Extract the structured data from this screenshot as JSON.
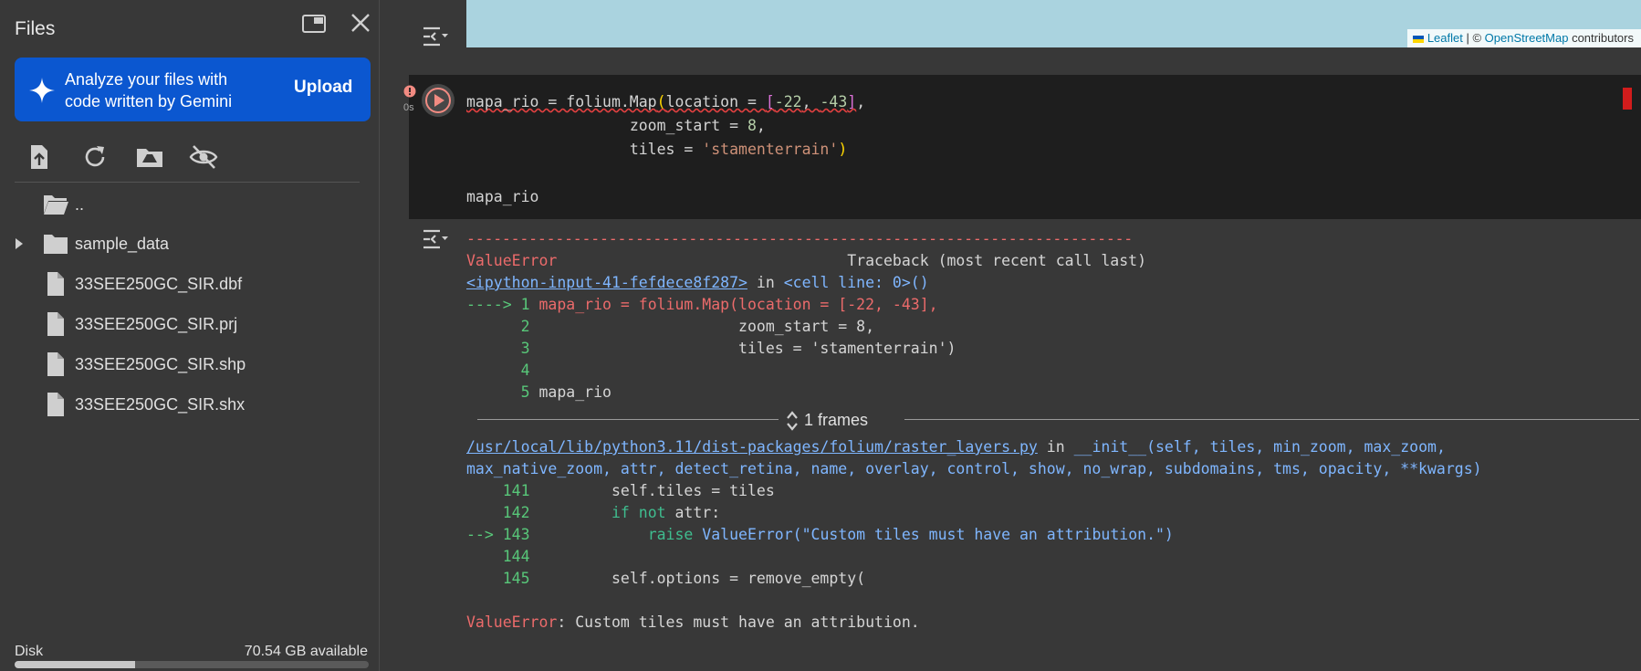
{
  "sidebar": {
    "title": "Files",
    "gemini": {
      "text": "Analyze your files with code written by Gemini",
      "upload_label": "Upload"
    },
    "tree": [
      {
        "label": "..",
        "kind": "parent-folder"
      },
      {
        "label": "sample_data",
        "kind": "folder"
      },
      {
        "label": "33SEE250GC_SIR.dbf",
        "kind": "file"
      },
      {
        "label": "33SEE250GC_SIR.prj",
        "kind": "file"
      },
      {
        "label": "33SEE250GC_SIR.shp",
        "kind": "file"
      },
      {
        "label": "33SEE250GC_SIR.shx",
        "kind": "file"
      }
    ],
    "disk": {
      "label": "Disk",
      "available": "70.54 GB available",
      "used_fraction": 0.34
    }
  },
  "map_attribution": {
    "leaflet": "Leaflet",
    "sep": " | © ",
    "osm": "OpenStreetMap",
    "contributors": " contributors"
  },
  "cell": {
    "exec_time": "0s",
    "code": {
      "line1_var": "mapa_rio = folium.Map",
      "line1_open": "(",
      "line1_kw": "location = ",
      "line1_bopen": "[",
      "line1_n1": "-22",
      "line1_comma": ", ",
      "line1_n2": "-43",
      "line1_bclose": "]",
      "line1_end": ",",
      "line2_pad": "                  ",
      "line2_kw": "zoom_start = ",
      "line2_num": "8",
      "line2_end": ",",
      "line3_pad": "                  ",
      "line3_kw": "tiles = ",
      "line3_str": "'stamenterrain'",
      "line3_close": ")",
      "line5": "mapa_rio"
    }
  },
  "output": {
    "dashes": "---------------------------------------------------------------------------",
    "error_type": "ValueError",
    "traceback_header": "                                Traceback (most recent call last)",
    "input_link": "<ipython-input-41-fefdece8f287>",
    "in_word": " in ",
    "cell_line": "<cell line: 0>",
    "cell_line_paren": "()",
    "src": [
      {
        "prefix": "----> 1 ",
        "code": "mapa_rio = folium.Map(location = [-22, -43],",
        "current": true
      },
      {
        "prefix": "      2 ",
        "code": "                      zoom_start = 8,",
        "current": false
      },
      {
        "prefix": "      3 ",
        "code": "                      tiles = 'stamenterrain')",
        "current": false
      },
      {
        "prefix": "      4 ",
        "code": "",
        "current": false
      },
      {
        "prefix": "      5 ",
        "code": "mapa_rio",
        "current": false
      }
    ],
    "frames_label": "1 frames",
    "lib_link": "/usr/local/lib/python3.11/dist-packages/folium/raster_layers.py",
    "lib_in": " in ",
    "lib_sig1": "__init__(self, tiles, min_zoom, max_zoom,",
    "lib_sig2": "max_native_zoom, attr, detect_retina, name, overlay, control, show, no_wrap, subdomains, tms, opacity, **kwargs)",
    "lib_lines": [
      {
        "prefix": "    141 ",
        "code": "        self.tiles = tiles"
      },
      {
        "prefix": "    142 ",
        "kw": "        if not",
        "code": " attr:"
      },
      {
        "prefix": "--> 143 ",
        "kw": "            raise",
        "code": " ValueError(\"Custom tiles must have an attribution.\")"
      },
      {
        "prefix": "    144 ",
        "code": ""
      },
      {
        "prefix": "    145 ",
        "code": "        self.options = remove_empty("
      }
    ],
    "final_error_type": "ValueError",
    "final_error_msg": ": Custom tiles must have an attribution."
  }
}
